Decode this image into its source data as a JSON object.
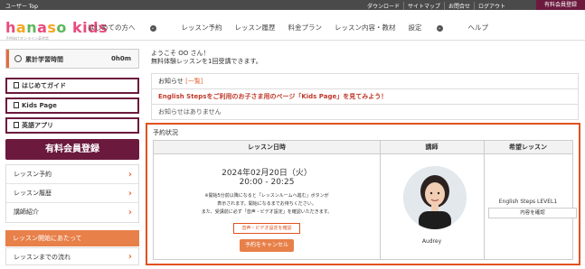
{
  "topbar": {
    "user": "ユーザー Top",
    "links": [
      "ダウンロード",
      "サイトマップ",
      "お問合せ",
      "ログアウト"
    ],
    "member_button": "有料会員登録"
  },
  "header": {
    "logo_text": "hanaso kids",
    "logo_sub": "子供向けオンライン英会話",
    "nav": [
      {
        "label": "はじめての方へ",
        "dropdown": true
      },
      {
        "label": "レッスン予約",
        "dropdown": false
      },
      {
        "label": "レッスン履歴",
        "dropdown": false
      },
      {
        "label": "料金プラン",
        "dropdown": false
      },
      {
        "label": "レッスン内容・教材",
        "dropdown": false
      },
      {
        "label": "設定",
        "dropdown": true
      },
      {
        "label": "ヘルプ",
        "dropdown": false
      }
    ]
  },
  "sidebar": {
    "study_time_label": "累計学習時間",
    "study_time_value": "0h0m",
    "guide_button": "はじめてガイド",
    "kids_page_button": "Kids Page",
    "english_app_button": "英語アプリ",
    "paid_button": "有料会員登録",
    "menu": [
      "レッスン予約",
      "レッスン履歴",
      "講師紹介"
    ],
    "section_heading": "レッスン開始にあたって",
    "section_item": "レッスンまでの流れ"
  },
  "main": {
    "welcome_line1": "ようこそ OO さん！",
    "welcome_line2": "無料体験レッスンを1回受講できます。",
    "notice_title": "お知らせ",
    "notice_link": "[一覧]",
    "promo": "English Stepsをご利用のお子さま用のページ「Kids Page」を見てみよう！",
    "no_notice": "お知らせはありません",
    "reservation": {
      "title": "予約状況",
      "col_datetime": "レッスン日時",
      "col_teacher": "講師",
      "col_lesson": "希望レッスン",
      "date": "2024年02月20日（火）",
      "time": "20:00 - 20:25",
      "note_line1": "※開始5分前以降になると「レッスンルームへ進む」ボタンが",
      "note_line2": "表示されます。開始になるまでお待ちください。",
      "note_line3": "また、受講前に必ず「音声・ビデオ設定」を確認いただきます。",
      "av_button": "音声・ビデオ設定を確認",
      "cancel_button": "予約をキャンセル",
      "teacher_name": "Audrey",
      "lesson_name": "English Steps LEVEL1",
      "detail_button": "内容を確認"
    }
  },
  "colors": {
    "brand_maroon": "#6b1a3e",
    "accent_orange": "#e0521f",
    "button_orange": "#e8804a"
  }
}
